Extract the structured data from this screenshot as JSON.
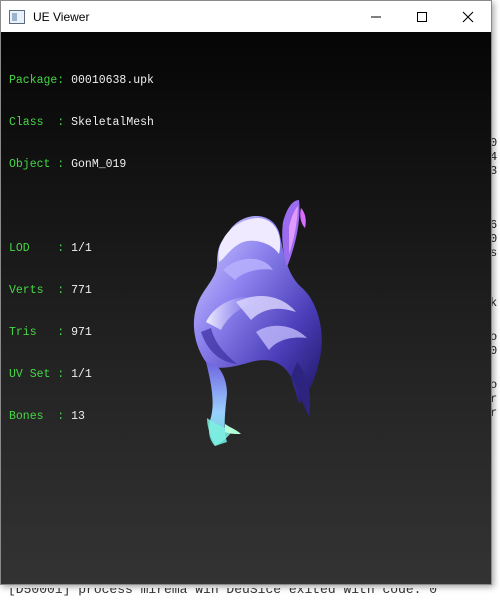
{
  "window": {
    "title": "UE Viewer",
    "controls": {
      "minimize": "minimize-icon",
      "maximize": "maximize-icon",
      "close": "close-icon"
    }
  },
  "info": {
    "package_label": "Package: ",
    "package_value": "00010638.upk",
    "class_label": "Class  : ",
    "class_value": "SkeletalMesh",
    "object_label": "Object : ",
    "object_value": "GonM_019",
    "lod_label": "LOD    : ",
    "lod_value": "1/1",
    "verts_label": "Verts  : ",
    "verts_value": "771",
    "tris_label": "Tris   : ",
    "tris_value": "971",
    "uvset_label": "UV Set : ",
    "uvset_value": "1/1",
    "bones_label": "Bones  : ",
    "bones_value": "13"
  },
  "background_console": {
    "bottom_line": "[D50001] process  mirema win DeuSice  exited with code: 0"
  },
  "colors": {
    "label_green": "#46d646",
    "value_white": "#f0f0f0",
    "mesh_primary": "#8f85f0"
  }
}
